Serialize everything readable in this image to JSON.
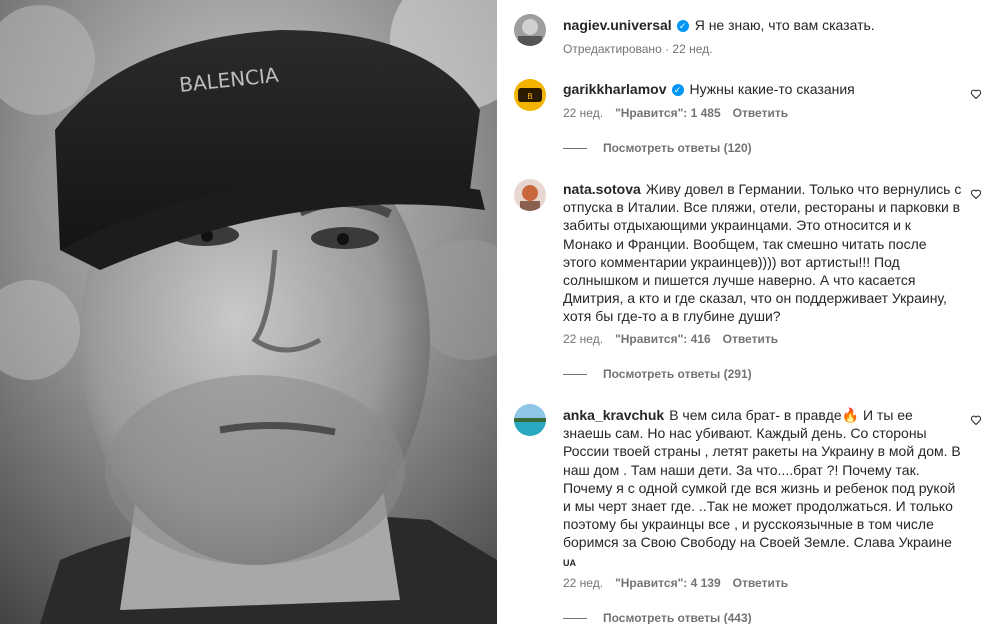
{
  "post": {
    "author": "nagiev.universal",
    "caption": "Я не знаю, что вам сказать.",
    "edited_label": "Отредактировано",
    "age": "22 нед."
  },
  "comments": [
    {
      "username": "garikkharlamov",
      "verified": true,
      "text": "Нужны какие-то сказания",
      "age": "22 нед.",
      "likes": "\"Нравится\": 1 485",
      "reply_label": "Ответить",
      "view_replies": "Посмотреть ответы (120)"
    },
    {
      "username": "nata.sotova",
      "verified": false,
      "text": "Живу довел в Германии. Только что вернулись с отпуска в Италии. Все пляжи, отели, рестораны и парковки в забиты отдыхающими украинцами. Это относится и к Монако и Франции. Вообщем, так смешно читать после этого комментарии украинцев)))) вот артисты!!! Под солнышком и пишется лучше наверно. А что касается Дмитрия, а кто и где сказал, что он поддерживает Украину, хотя бы где-то а в глубине души?",
      "age": "22 нед.",
      "likes": "\"Нравится\": 416",
      "reply_label": "Ответить",
      "view_replies": "Посмотреть ответы (291)"
    },
    {
      "username": "anka_kravchuk",
      "verified": false,
      "text": "В чем сила брат- в правде🔥 И ты ее знаешь сам. Но нас убивают. Каждый день. Со стороны России твоей страны , летят ракеты на Украину в мой дом. В наш дом . Там наши дети. За что....брат ?! Почему так. Почему я с одной сумкой где вся жизнь и ребенок под рукой и мы черт знает где. ..Так не может продолжаться. И только поэтому бы украинцы все , и русскоязычные в том числе боримся за Свою Свободу на Своей Земле. Слава Украине",
      "flag": "UA",
      "age": "22 нед.",
      "likes": "\"Нравится\": 4 139",
      "reply_label": "Ответить",
      "view_replies": "Посмотреть ответы (443)"
    }
  ],
  "image_text": {
    "cap_brand": "BALENCIA"
  },
  "colors": {
    "verified": "#0095f6",
    "secondary_text": "#737373",
    "primary_text": "#262626"
  }
}
